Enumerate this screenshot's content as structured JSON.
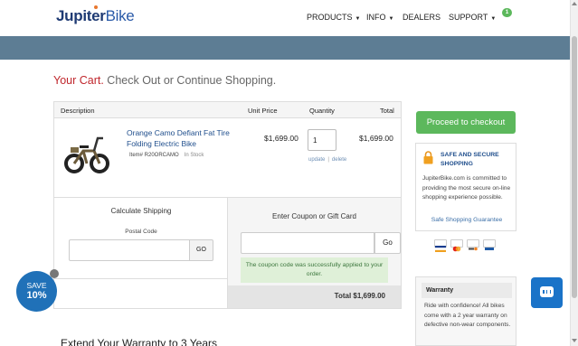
{
  "header": {
    "logo_part1": "Jupiter",
    "logo_part2": "Bike",
    "nav": [
      {
        "label": "PRODUCTS",
        "dropdown": true
      },
      {
        "label": "INFO",
        "dropdown": true
      },
      {
        "label": "DEALERS",
        "dropdown": false
      },
      {
        "label": "SUPPORT",
        "dropdown": true
      }
    ],
    "cart_count": "1"
  },
  "page": {
    "title_red": "Your Cart.",
    "title_rest": " Check Out or Continue Shopping."
  },
  "cart": {
    "columns": [
      "Description",
      "Unit Price",
      "Quantity",
      "Total"
    ],
    "item": {
      "name": "Orange Camo Defiant Fat Tire Folding Electric Bike",
      "item_no": "Item# R20ORCAMO",
      "stock": "In Stock",
      "unit_price": "$1,699.00",
      "quantity": "1",
      "update": "update",
      "delete": "delete",
      "total": "$1,699.00"
    },
    "shipping": {
      "title": "Calculate Shipping",
      "postal_label": "Postal Code",
      "postal_value": "",
      "go": "GO"
    },
    "coupon": {
      "title": "Enter Coupon or Gift Card",
      "value": "",
      "go": "Go",
      "message": "The coupon code was successfully applied to your order."
    },
    "grand_total": "Total $1,699.00"
  },
  "sidebar": {
    "checkout": "Proceed to checkout",
    "secure_title": "SAFE AND SECURE SHOPPING",
    "secure_text": "JupiterBike.com is committed to providing the most secure on-line shopping experience possible.",
    "secure_link": "Safe Shopping Guarantee",
    "cards": [
      "VISA",
      "MC",
      "DISC",
      "PP"
    ],
    "warranty_title": "Warranty",
    "warranty_text": "Ride with confidence! All bikes come with a 2 year warranty on defective non-wear components."
  },
  "extend_heading": "Extend Your Warranty to 3 Years",
  "promo": {
    "save": "SAVE",
    "percent": "10%"
  },
  "colors": {
    "brand_blue": "#1e3a73",
    "band": "#5d7d94",
    "green": "#5cb85c",
    "red": "#c0272d",
    "save_badge": "#2071b8"
  }
}
